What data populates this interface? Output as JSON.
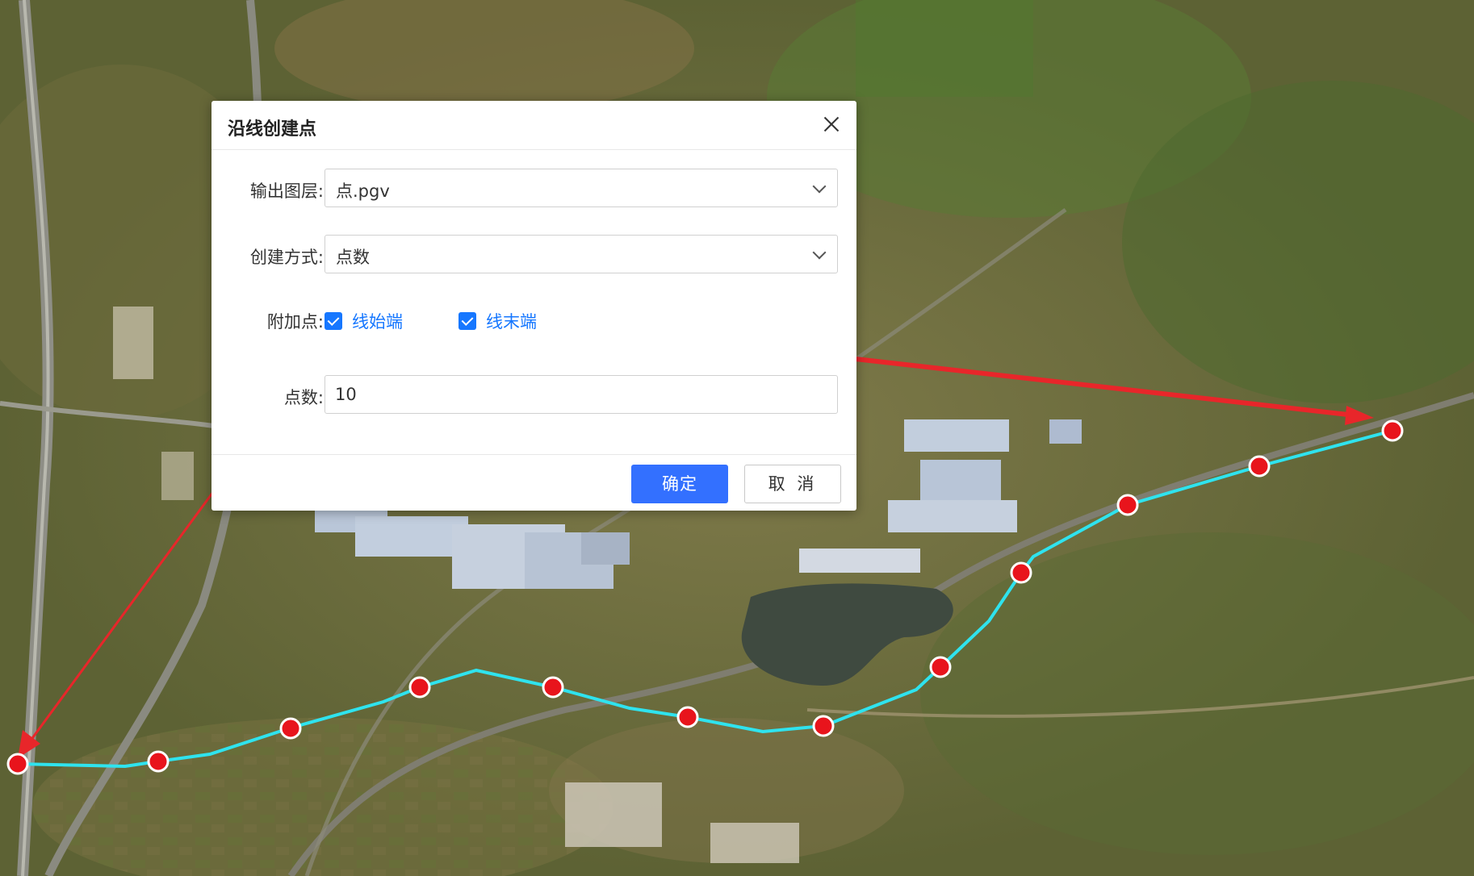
{
  "dialog": {
    "title": "沿线创建点",
    "output_layer": {
      "label": "输出图层:",
      "value": "点.pgv"
    },
    "create_method": {
      "label": "创建方式:",
      "value": "点数"
    },
    "extra_points": {
      "label": "附加点:",
      "start": {
        "label": "线始端",
        "checked": true
      },
      "end": {
        "label": "线末端",
        "checked": true
      }
    },
    "point_count": {
      "label": "点数:",
      "value": "10"
    },
    "ok_label": "确定",
    "cancel_label": "取 消"
  },
  "colors": {
    "line": "#2fe3ee",
    "point_fill": "#e8141c",
    "arrow": "#e8262a",
    "primary": "#3370ff",
    "checkbox": "#1677ff"
  }
}
